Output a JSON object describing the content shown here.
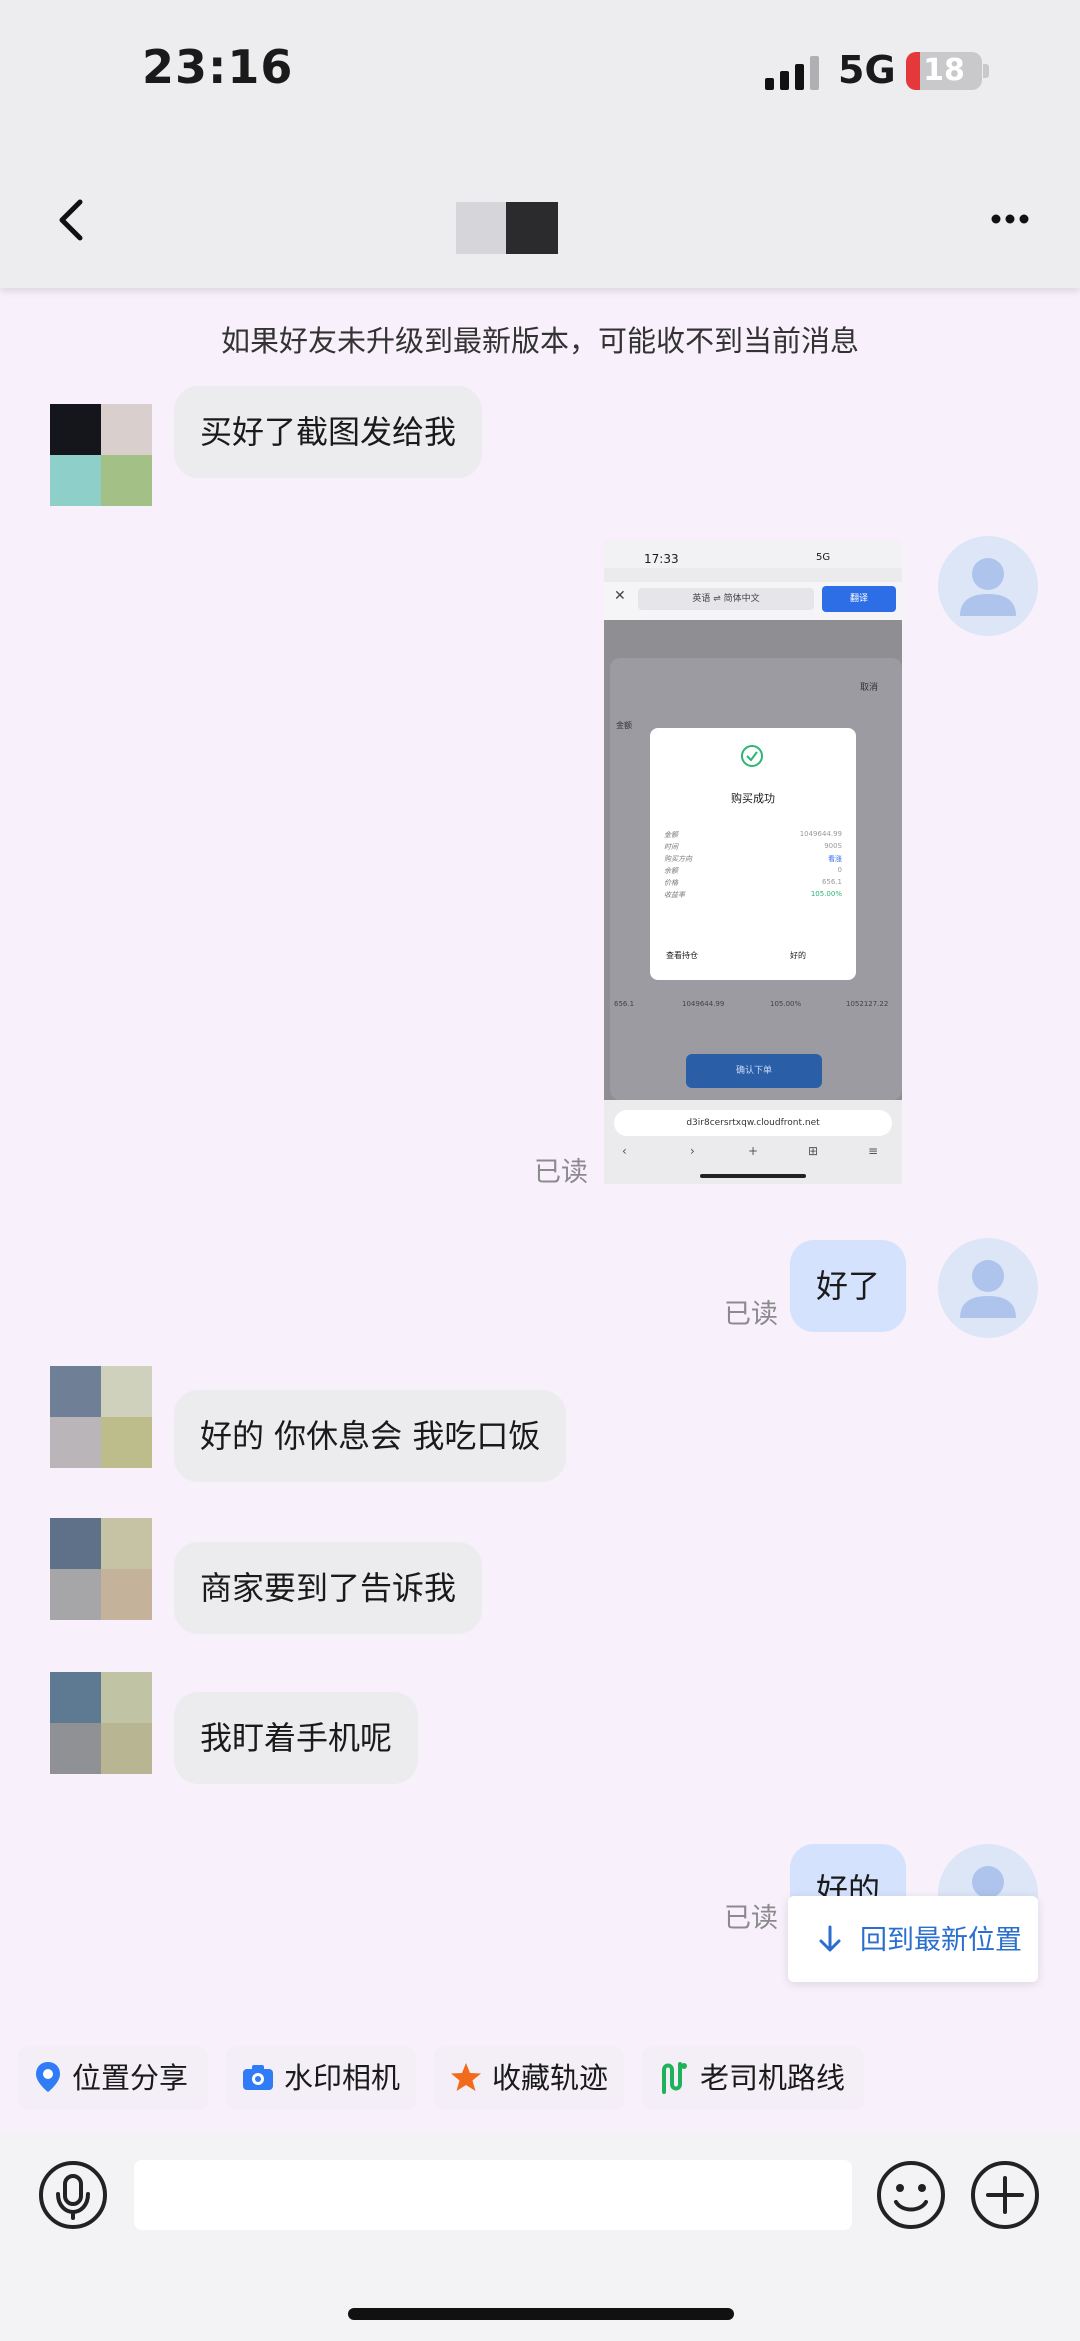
{
  "status_bar": {
    "time": "23:16",
    "network": "5G",
    "battery": "18"
  },
  "nav": {
    "back_icon": "chevron-left-icon",
    "more_icon": "more-horizontal-icon"
  },
  "system_notice": "如果好友未升级到最新版本，可能收不到当前消息",
  "messages": [
    {
      "from": "other",
      "type": "text",
      "text": "买好了截图发给我"
    },
    {
      "from": "me",
      "type": "image",
      "read": "已读",
      "image": {
        "time": "17:33",
        "signal": "5G",
        "translate_langs": "英语 ⇌ 简体中文",
        "translate_button": "翻译",
        "cancel": "取消",
        "amount_label": "金额",
        "dialog_title": "购买成功",
        "dialog_rows": [
          {
            "label": "金额",
            "value": "1049644.99"
          },
          {
            "label": "时间",
            "value": "900S"
          },
          {
            "label": "购买方向",
            "value": "看涨"
          },
          {
            "label": "余额",
            "value": "0"
          },
          {
            "label": "价格",
            "value": "656.1"
          },
          {
            "label": "收益率",
            "value": "105.00%"
          }
        ],
        "dialog_left_button": "查看持仓",
        "dialog_right_button": "好的",
        "stats": [
          "656.1",
          "1049644.99",
          "105.00%",
          "1052127.22"
        ],
        "buy_button": "确认下单",
        "url": "d3ir8cersrtxqw.cloudfront.net"
      }
    },
    {
      "from": "me",
      "type": "text",
      "text": "好了",
      "read": "已读"
    },
    {
      "from": "other",
      "type": "text",
      "text": "好的 你休息会 我吃口饭"
    },
    {
      "from": "other",
      "type": "text",
      "text": "商家要到了告诉我"
    },
    {
      "from": "other",
      "type": "text",
      "text": "我盯着手机呢"
    },
    {
      "from": "me",
      "type": "text",
      "text": "好的",
      "read": "已读"
    }
  ],
  "toast": {
    "label": "回到最新位置",
    "icon": "arrow-down-icon"
  },
  "quick_tools": [
    {
      "label": "位置分享",
      "icon": "location-pin-icon",
      "color": "#2f7cf6"
    },
    {
      "label": "水印相机",
      "icon": "camera-icon",
      "color": "#2f7cf6"
    },
    {
      "label": "收藏轨迹",
      "icon": "star-icon",
      "color": "#f26a1b"
    },
    {
      "label": "老司机路线",
      "icon": "route-icon",
      "color": "#1fb25a"
    }
  ],
  "input": {
    "placeholder": ""
  },
  "colors": {
    "background": "#f8f1fb",
    "bubble_in": "#ececef",
    "bubble_out": "#d4e2fd",
    "accent": "#2a6ecf"
  }
}
